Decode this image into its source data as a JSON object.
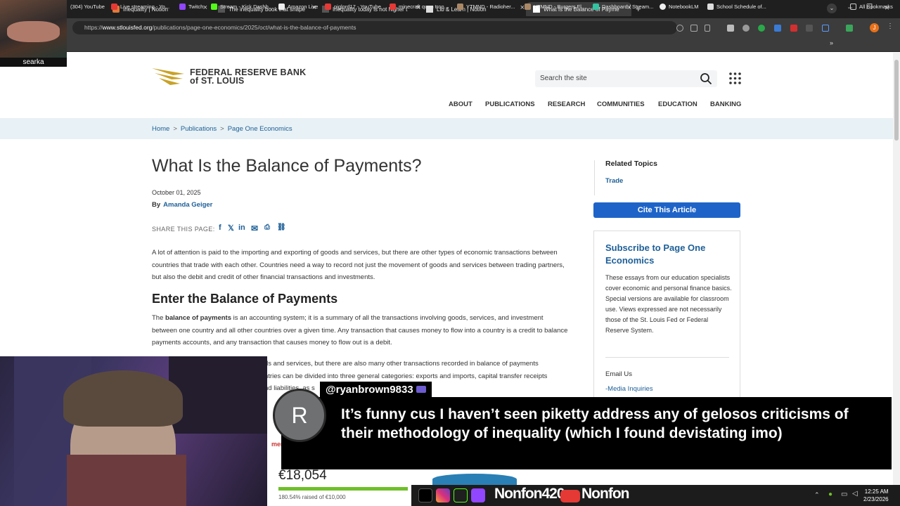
{
  "browser": {
    "tabs": [
      {
        "label": "Inequality | Notion"
      },
      {
        "label": "The inequality book that shape"
      },
      {
        "label": "Inequality today is not higher t"
      },
      {
        "label": "Lib & Learn | Notion"
      },
      {
        "label": "What Is the Balance of Payme"
      }
    ],
    "url_prefix": "https://",
    "url_domain": "www.stlouisfed.org",
    "url_path": "/publications/page-one-economics/2025/oct/what-is-the-balance-of-payments",
    "bookmarks": [
      "(304) YouTube",
      "Live streaming - Yo...",
      "Twitch",
      "Stream - Kick Dashb...",
      "Amazon Live",
      "piglord17 - YouTube",
      "minecraft quan tron...",
      "YTMND - Radioher...",
      "YTMND - Burgers Fl...",
      "Dashboard / Stream...",
      "NotebookLM",
      "School Schedule of..."
    ],
    "all_bookmarks": "All Bookmarks",
    "profile_initial": "J"
  },
  "site": {
    "logo_line1": "FEDERAL RESERVE BANK",
    "logo_line2": "of ST. LOUIS",
    "search_placeholder": "Search the site",
    "nav": [
      "ABOUT",
      "PUBLICATIONS",
      "RESEARCH",
      "COMMUNITIES",
      "EDUCATION",
      "BANKING"
    ],
    "breadcrumbs": [
      "Home",
      "Publications",
      "Page One Economics"
    ],
    "breadcrumb_sep": ">",
    "title": "What Is the Balance of Payments?",
    "date": "October 01, 2025",
    "by": "By",
    "author": "Amanda Geiger",
    "share_label": "SHARE THIS PAGE:",
    "para1": "A lot of attention is paid to the importing and exporting of goods and services, but there are other types of economic transactions between countries that trade with each other. Countries need a way to record not just the movement of goods and services between trading partners, but also the debit and credit of other financial transactions and investments.",
    "h2": "Enter the Balance of Payments",
    "para2_the": "The ",
    "para2_bold": "balance of payments",
    "para2_rest": " is an accounting system; it is a summary of all the transactions involving goods, services, and investment between one country and all other countries over a given time. Any transaction that causes money to flow into a country is a credit to balance payments accounts, and any transaction that causes money to flow out is a debit.",
    "para3_line1": "ds and services, but there are also many other transactions recorded in balance of payments",
    "para3_line2": "ntries can be divided into three general categories: exports and imports, capital transfer receipts",
    "para3_line3": "nd liabilities, as s",
    "related_heading": "Related Topics",
    "related_topic": "Trade",
    "cite_button": "Cite This Article",
    "subscribe_heading": "Subscribe to Page One Economics",
    "subscribe_text": "These essays from our education specialists cover economic and personal finance basics. Special versions are available for classroom use. Views expressed are not necessarily those of the St. Louis Fed or Federal Reserve System.",
    "email_us": "Email Us",
    "media_inquiries": "-Media Inquiries"
  },
  "overlay": {
    "cam_name": "searka",
    "chat_user": "@ryanbrown9833",
    "chat_avatar_letter": "R",
    "chat_message": "It’s funny cus I haven’t seen piketty address any of gelosos criticisms of their methodology of inequality (which I found devistating imo)",
    "donation_amount": "€18,054",
    "donation_progress_pct": 180.54,
    "donation_sub": "180.54% raised of €10,000",
    "donation_partial": "men",
    "social_handle_1": "Nonfon420",
    "social_handle_2": "Nonfon",
    "clock_time": "12:25 AM",
    "clock_date": "2/23/2026"
  },
  "colors": {
    "brand_blue": "#1d5f97",
    "cite_blue": "#1e64c8",
    "logo_gold": "#c9a227"
  }
}
